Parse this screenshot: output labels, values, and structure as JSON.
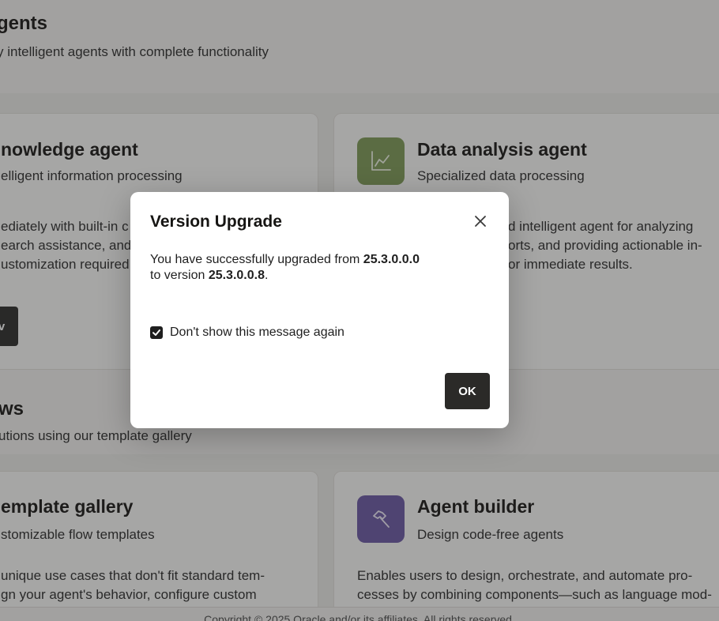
{
  "agents_section": {
    "title": "gents",
    "subtitle": "y intelligent agents with complete functionality"
  },
  "knowledge_card": {
    "title": "nowledge agent",
    "subtitle": "elligent information processing",
    "desc": [
      "ediately with built-in c",
      "earch assistance, and",
      "ustomization required"
    ],
    "button_label": "v"
  },
  "data_card": {
    "title": "Data analysis agent",
    "subtitle": "Specialized data processing",
    "desc": [
      "d intelligent agent for analyzing",
      "orts, and providing actionable in-",
      "or immediate results."
    ],
    "icon": "chart-line-icon",
    "icon_color": "#6f8a4a"
  },
  "flows_section": {
    "title": "ws",
    "subtitle": "utions using our template gallery"
  },
  "template_card": {
    "title": "emplate gallery",
    "subtitle": "stomizable flow templates",
    "desc": [
      "unique use cases that don't fit standard tem-",
      "gn your agent's behavior, configure custom"
    ]
  },
  "builder_card": {
    "title": "Agent builder",
    "subtitle": "Design code-free agents",
    "desc": [
      "Enables users to design, orchestrate, and automate pro-",
      "cesses by combining components—such as language mod-"
    ],
    "icon": "hammer-icon",
    "icon_color": "#5b4a8e"
  },
  "footer": {
    "text": "Copyright © 2025 Oracle and/or its affiliates. All rights reserved."
  },
  "modal": {
    "title": "Version Upgrade",
    "body_prefix": "You have successfully upgraded from ",
    "from_version": "25.3.0.0.0",
    "body_mid": "to version ",
    "to_version": "25.3.0.0.8",
    "body_suffix": ".",
    "checkbox_label": "Don't show this message again",
    "checkbox_checked": true,
    "ok_label": "OK",
    "close_icon": "close-icon"
  }
}
